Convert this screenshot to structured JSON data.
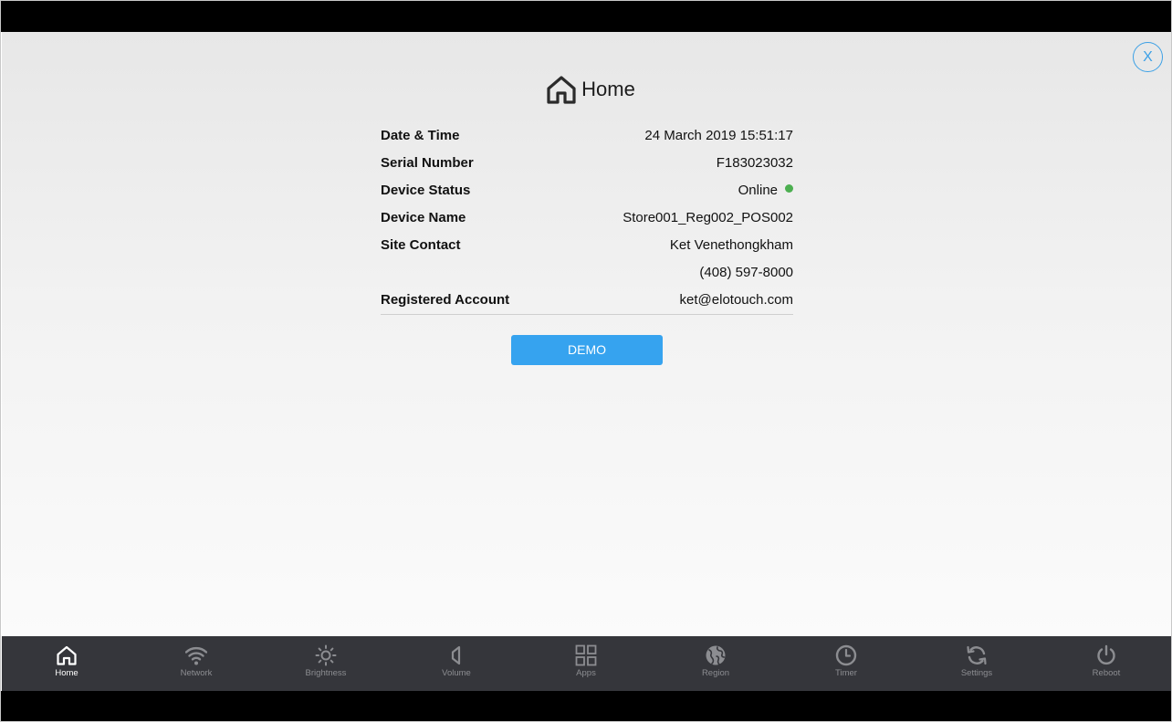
{
  "header": {
    "title": "Home",
    "close_label": "X"
  },
  "info": {
    "rows": [
      {
        "label": "Date & Time",
        "value": "24 March 2019 15:51:17"
      },
      {
        "label": "Serial Number",
        "value": "F183023032"
      },
      {
        "label": "Device Status",
        "value": "Online"
      },
      {
        "label": "Device Name",
        "value": "Store001_Reg002_POS002"
      },
      {
        "label": "Site Contact",
        "value": "Ket Venethongkham"
      },
      {
        "label": "",
        "value": "(408) 597-8000"
      },
      {
        "label": "Registered Account",
        "value": "ket@elotouch.com"
      }
    ]
  },
  "demo_button": {
    "label": "DEMO"
  },
  "nav": {
    "items": [
      {
        "label": "Home",
        "icon": "home-icon",
        "active": true
      },
      {
        "label": "Network",
        "icon": "wifi-icon",
        "active": false
      },
      {
        "label": "Brightness",
        "icon": "brightness-icon",
        "active": false
      },
      {
        "label": "Volume",
        "icon": "volume-icon",
        "active": false
      },
      {
        "label": "Apps",
        "icon": "apps-grid-icon",
        "active": false
      },
      {
        "label": "Region",
        "icon": "globe-icon",
        "active": false
      },
      {
        "label": "Timer",
        "icon": "clock-icon",
        "active": false
      },
      {
        "label": "Settings",
        "icon": "sync-icon",
        "active": false
      },
      {
        "label": "Reboot",
        "icon": "power-icon",
        "active": false
      }
    ]
  },
  "colors": {
    "accent": "#3ba0e6",
    "demo_button": "#36a3ef",
    "online": "#4caf50",
    "nav_bg": "#35363b",
    "nav_active": "#ffffff",
    "nav_inactive": "#8c8d91"
  }
}
